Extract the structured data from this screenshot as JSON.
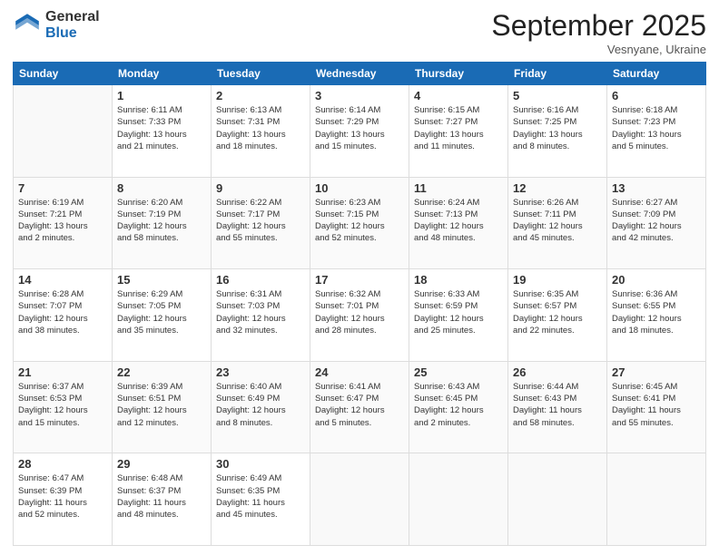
{
  "logo": {
    "general": "General",
    "blue": "Blue"
  },
  "header": {
    "month": "September 2025",
    "location": "Vesnyane, Ukraine"
  },
  "weekdays": [
    "Sunday",
    "Monday",
    "Tuesday",
    "Wednesday",
    "Thursday",
    "Friday",
    "Saturday"
  ],
  "weeks": [
    [
      {
        "day": "",
        "info": ""
      },
      {
        "day": "1",
        "info": "Sunrise: 6:11 AM\nSunset: 7:33 PM\nDaylight: 13 hours\nand 21 minutes."
      },
      {
        "day": "2",
        "info": "Sunrise: 6:13 AM\nSunset: 7:31 PM\nDaylight: 13 hours\nand 18 minutes."
      },
      {
        "day": "3",
        "info": "Sunrise: 6:14 AM\nSunset: 7:29 PM\nDaylight: 13 hours\nand 15 minutes."
      },
      {
        "day": "4",
        "info": "Sunrise: 6:15 AM\nSunset: 7:27 PM\nDaylight: 13 hours\nand 11 minutes."
      },
      {
        "day": "5",
        "info": "Sunrise: 6:16 AM\nSunset: 7:25 PM\nDaylight: 13 hours\nand 8 minutes."
      },
      {
        "day": "6",
        "info": "Sunrise: 6:18 AM\nSunset: 7:23 PM\nDaylight: 13 hours\nand 5 minutes."
      }
    ],
    [
      {
        "day": "7",
        "info": "Sunrise: 6:19 AM\nSunset: 7:21 PM\nDaylight: 13 hours\nand 2 minutes."
      },
      {
        "day": "8",
        "info": "Sunrise: 6:20 AM\nSunset: 7:19 PM\nDaylight: 12 hours\nand 58 minutes."
      },
      {
        "day": "9",
        "info": "Sunrise: 6:22 AM\nSunset: 7:17 PM\nDaylight: 12 hours\nand 55 minutes."
      },
      {
        "day": "10",
        "info": "Sunrise: 6:23 AM\nSunset: 7:15 PM\nDaylight: 12 hours\nand 52 minutes."
      },
      {
        "day": "11",
        "info": "Sunrise: 6:24 AM\nSunset: 7:13 PM\nDaylight: 12 hours\nand 48 minutes."
      },
      {
        "day": "12",
        "info": "Sunrise: 6:26 AM\nSunset: 7:11 PM\nDaylight: 12 hours\nand 45 minutes."
      },
      {
        "day": "13",
        "info": "Sunrise: 6:27 AM\nSunset: 7:09 PM\nDaylight: 12 hours\nand 42 minutes."
      }
    ],
    [
      {
        "day": "14",
        "info": "Sunrise: 6:28 AM\nSunset: 7:07 PM\nDaylight: 12 hours\nand 38 minutes."
      },
      {
        "day": "15",
        "info": "Sunrise: 6:29 AM\nSunset: 7:05 PM\nDaylight: 12 hours\nand 35 minutes."
      },
      {
        "day": "16",
        "info": "Sunrise: 6:31 AM\nSunset: 7:03 PM\nDaylight: 12 hours\nand 32 minutes."
      },
      {
        "day": "17",
        "info": "Sunrise: 6:32 AM\nSunset: 7:01 PM\nDaylight: 12 hours\nand 28 minutes."
      },
      {
        "day": "18",
        "info": "Sunrise: 6:33 AM\nSunset: 6:59 PM\nDaylight: 12 hours\nand 25 minutes."
      },
      {
        "day": "19",
        "info": "Sunrise: 6:35 AM\nSunset: 6:57 PM\nDaylight: 12 hours\nand 22 minutes."
      },
      {
        "day": "20",
        "info": "Sunrise: 6:36 AM\nSunset: 6:55 PM\nDaylight: 12 hours\nand 18 minutes."
      }
    ],
    [
      {
        "day": "21",
        "info": "Sunrise: 6:37 AM\nSunset: 6:53 PM\nDaylight: 12 hours\nand 15 minutes."
      },
      {
        "day": "22",
        "info": "Sunrise: 6:39 AM\nSunset: 6:51 PM\nDaylight: 12 hours\nand 12 minutes."
      },
      {
        "day": "23",
        "info": "Sunrise: 6:40 AM\nSunset: 6:49 PM\nDaylight: 12 hours\nand 8 minutes."
      },
      {
        "day": "24",
        "info": "Sunrise: 6:41 AM\nSunset: 6:47 PM\nDaylight: 12 hours\nand 5 minutes."
      },
      {
        "day": "25",
        "info": "Sunrise: 6:43 AM\nSunset: 6:45 PM\nDaylight: 12 hours\nand 2 minutes."
      },
      {
        "day": "26",
        "info": "Sunrise: 6:44 AM\nSunset: 6:43 PM\nDaylight: 11 hours\nand 58 minutes."
      },
      {
        "day": "27",
        "info": "Sunrise: 6:45 AM\nSunset: 6:41 PM\nDaylight: 11 hours\nand 55 minutes."
      }
    ],
    [
      {
        "day": "28",
        "info": "Sunrise: 6:47 AM\nSunset: 6:39 PM\nDaylight: 11 hours\nand 52 minutes."
      },
      {
        "day": "29",
        "info": "Sunrise: 6:48 AM\nSunset: 6:37 PM\nDaylight: 11 hours\nand 48 minutes."
      },
      {
        "day": "30",
        "info": "Sunrise: 6:49 AM\nSunset: 6:35 PM\nDaylight: 11 hours\nand 45 minutes."
      },
      {
        "day": "",
        "info": ""
      },
      {
        "day": "",
        "info": ""
      },
      {
        "day": "",
        "info": ""
      },
      {
        "day": "",
        "info": ""
      }
    ]
  ]
}
